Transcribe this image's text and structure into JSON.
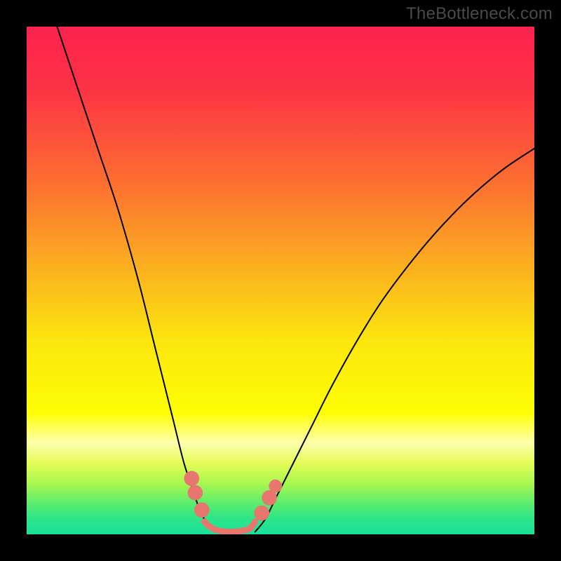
{
  "watermark": "TheBottleneck.com",
  "chart_data": {
    "type": "line",
    "title": "",
    "xlabel": "",
    "ylabel": "",
    "xlim": [
      0,
      100
    ],
    "ylim": [
      0,
      100
    ],
    "grid": false,
    "series": [
      {
        "name": "left-curve",
        "x": [
          6,
          10,
          14,
          18,
          22,
          25,
          27,
          29,
          31,
          33,
          34,
          35,
          36,
          37
        ],
        "y": [
          100,
          88,
          76,
          64,
          50,
          38,
          30,
          22,
          14,
          8,
          5,
          3,
          1.5,
          0.5
        ],
        "color": "#000000",
        "linewidth": 2
      },
      {
        "name": "right-curve",
        "x": [
          45,
          47,
          49,
          52,
          56,
          60,
          65,
          70,
          76,
          82,
          88,
          94,
          100
        ],
        "y": [
          0.5,
          3,
          7,
          13,
          21,
          29,
          38,
          46,
          54,
          61,
          67,
          72,
          76
        ],
        "color": "#000000",
        "linewidth": 2
      },
      {
        "name": "bottom-connector",
        "x": [
          35,
          36.5,
          38,
          39.5,
          41,
          42.5,
          44,
          45
        ],
        "y": [
          2.5,
          1.2,
          0.7,
          0.5,
          0.5,
          0.7,
          1.2,
          2.5
        ],
        "color": "#e7766e",
        "linewidth": 9
      }
    ],
    "markers": [
      {
        "x": 32.5,
        "y": 11,
        "r": 1.5,
        "color": "#e7766e"
      },
      {
        "x": 33.2,
        "y": 8.2,
        "r": 1.5,
        "color": "#e7766e"
      },
      {
        "x": 34.5,
        "y": 4.8,
        "r": 1.5,
        "color": "#e7766e"
      },
      {
        "x": 46.3,
        "y": 4.2,
        "r": 1.5,
        "color": "#e7766e"
      },
      {
        "x": 47.8,
        "y": 7.2,
        "r": 1.5,
        "color": "#e7766e"
      },
      {
        "x": 49.0,
        "y": 9.5,
        "r": 1.3,
        "color": "#e7766e"
      }
    ],
    "background_gradient": {
      "stops": [
        {
          "offset": 0.0,
          "color": "#fd2250"
        },
        {
          "offset": 0.12,
          "color": "#fd3245"
        },
        {
          "offset": 0.3,
          "color": "#fc6c32"
        },
        {
          "offset": 0.48,
          "color": "#fbb21f"
        },
        {
          "offset": 0.62,
          "color": "#fbe60e"
        },
        {
          "offset": 0.76,
          "color": "#fdfe03"
        },
        {
          "offset": 0.82,
          "color": "#fdffad"
        },
        {
          "offset": 0.86,
          "color": "#e4fc56"
        },
        {
          "offset": 0.9,
          "color": "#a7f74f"
        },
        {
          "offset": 0.94,
          "color": "#59ec6e"
        },
        {
          "offset": 0.97,
          "color": "#2ce589"
        },
        {
          "offset": 1.0,
          "color": "#18e19a"
        }
      ]
    }
  }
}
